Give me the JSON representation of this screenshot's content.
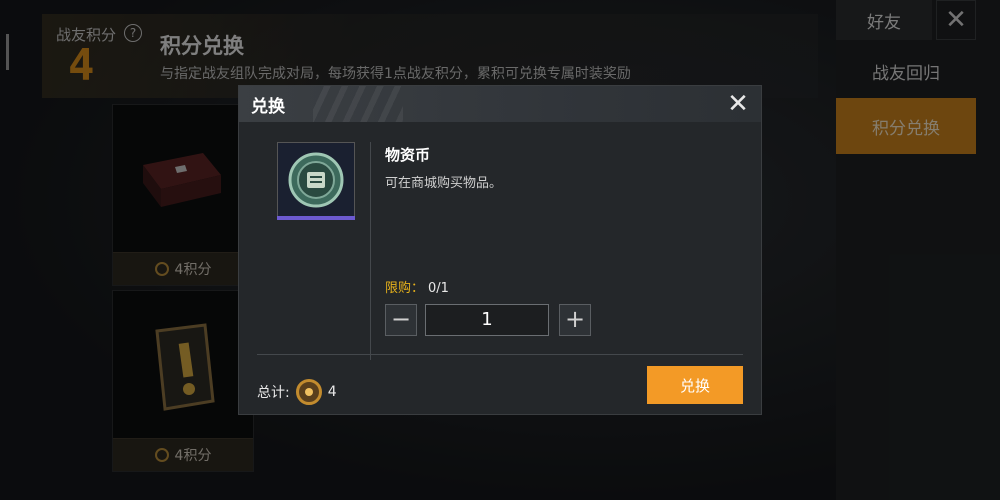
{
  "header": {
    "points_label": "战友积分",
    "points_value": "4",
    "title": "积分兑换",
    "description": "与指定战友组队完成对局，每场获得1点战友积分，累积可兑换专属时装奖励"
  },
  "cards": [
    {
      "cost": "4积分",
      "art_icon": "supply-crate-icon"
    },
    {
      "cost": "4积分",
      "art_icon": "badge-card-icon"
    }
  ],
  "sidebar": {
    "tab_friends": "好友",
    "close_icon": "close-icon",
    "item_return": "战友回归",
    "item_redeem": "积分兑换"
  },
  "modal": {
    "title": "兑换",
    "item_name": "物资币",
    "item_description": "可在商城购买物品。",
    "limit_label": "限购：",
    "limit_value": "0/1",
    "quantity": "1",
    "total_label": "总计:",
    "total_value": "4",
    "redeem_label": "兑换"
  },
  "colors": {
    "accent": "#f39a26",
    "limit": "#e7b21b",
    "points": "#d68a1a"
  }
}
